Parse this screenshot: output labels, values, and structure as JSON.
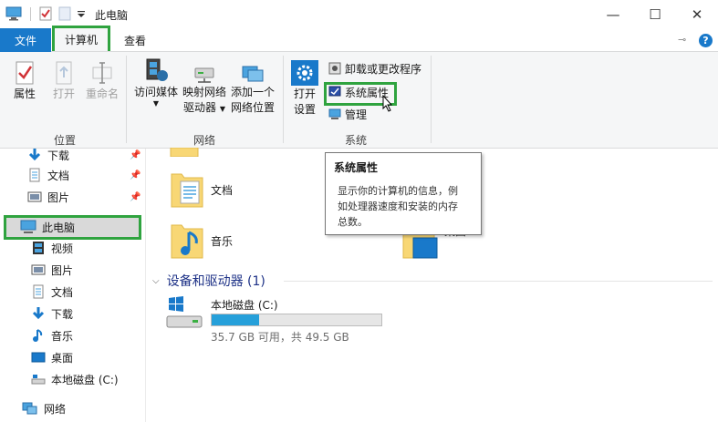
{
  "window": {
    "title": "此电脑",
    "minimize": "—",
    "maximize": "☐",
    "close": "✕"
  },
  "ribbon_tabs": {
    "file": "文件",
    "computer": "计算机",
    "view": "查看",
    "help": "?"
  },
  "ribbon": {
    "location": {
      "label": "位置",
      "properties": "属性",
      "open": "打开",
      "rename": "重命名"
    },
    "network": {
      "label": "网络",
      "access_media": "访问媒体",
      "map_drive_1": "映射网络",
      "map_drive_2": "驱动器",
      "add_location_1": "添加一个",
      "add_location_2": "网络位置"
    },
    "system": {
      "label": "系统",
      "open_settings_1": "打开",
      "open_settings_2": "设置",
      "uninstall": "卸载或更改程序",
      "system_properties": "系统属性",
      "manage": "管理"
    }
  },
  "tooltip": {
    "title": "系统属性",
    "body_line1": "显示你的计算机的信息，例",
    "body_line2": "如处理器速度和安装的内存",
    "body_line3": "总数。"
  },
  "nav": {
    "downloads_top": "下载",
    "documents_top": "文档",
    "pictures_top": "图片",
    "this_pc": "此电脑",
    "videos": "视频",
    "pictures": "图片",
    "documents": "文档",
    "downloads": "下载",
    "music": "音乐",
    "desktop": "桌面",
    "local_disk": "本地磁盘 (C:)",
    "network": "网络"
  },
  "content": {
    "documents": "文档",
    "music": "音乐",
    "desktop": "桌面",
    "devices_header": "设备和驱动器 (1)",
    "drive_name": "本地磁盘 (C:)",
    "drive_info": "35.7 GB 可用，共 49.5 GB",
    "drive_used_fraction": 0.28
  }
}
